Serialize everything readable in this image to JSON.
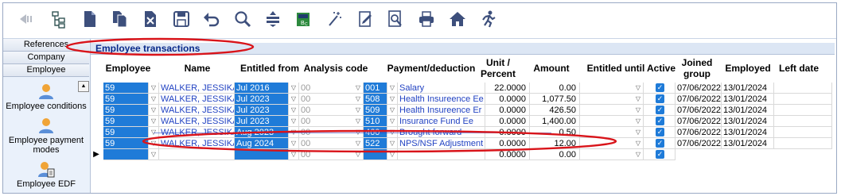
{
  "left_panel": {
    "tabs": [
      "References",
      "Company",
      "Employee"
    ],
    "items": [
      {
        "label": "Employee conditions",
        "icon": "person-icon"
      },
      {
        "label": "Employee payment modes",
        "icon": "person-icon"
      },
      {
        "label": "Employee EDF",
        "icon": "person-document-icon"
      }
    ]
  },
  "section_title": "Employee transactions",
  "columns": {
    "employee": "Employee",
    "name": "Name",
    "entitled_from": "Entitled from",
    "analysis_code": "Analysis code",
    "payment": "Payment/deduction",
    "unit": "Unit / Percent",
    "amount": "Amount",
    "entitled_until": "Entitled until",
    "active": "Active",
    "joined": "Joined group",
    "employed": "Employed",
    "left": "Left date"
  },
  "rows": [
    {
      "emp": "59",
      "name": "WALKER, JESSIKA",
      "from": "Jul 2016",
      "code": "00",
      "pay_no": "001",
      "pay": "Salary",
      "unit": "22.0000",
      "amount": "0.00",
      "joined": "07/06/2022",
      "employed": "13/01/2024"
    },
    {
      "emp": "59",
      "name": "WALKER, JESSIKA",
      "from": "Jul 2023",
      "code": "00",
      "pay_no": "508",
      "pay": "Health Insureence Ee",
      "unit": "0.0000",
      "amount": "1,077.50",
      "joined": "07/06/2022",
      "employed": "13/01/2024"
    },
    {
      "emp": "59",
      "name": "WALKER, JESSIKA",
      "from": "Jul 2023",
      "code": "00",
      "pay_no": "509",
      "pay": "Health Insureence Er",
      "unit": "0.0000",
      "amount": "426.50",
      "joined": "07/06/2022",
      "employed": "13/01/2024"
    },
    {
      "emp": "59",
      "name": "WALKER, JESSIKA",
      "from": "Jul 2023",
      "code": "00",
      "pay_no": "510",
      "pay": "Insurance Fund Ee",
      "unit": "0.0000",
      "amount": "1,400.00",
      "joined": "07/06/2022",
      "employed": "13/01/2024"
    },
    {
      "emp": "59",
      "name": "WALKER, JESSIKA",
      "from": "Aug 2023",
      "code": "00",
      "pay_no": "460",
      "pay": "Brought forward",
      "unit": "0.0000",
      "amount": "0.50",
      "joined": "07/06/2022",
      "employed": "13/01/2024"
    },
    {
      "emp": "59",
      "name": "WALKER, JESSIKA",
      "from": "Aug 2024",
      "code": "00",
      "pay_no": "522",
      "pay": "NPS/NSF Adjustment",
      "unit": "0.0000",
      "amount": "12.00",
      "joined": "07/06/2022",
      "employed": "13/01/2024"
    }
  ],
  "new_row": {
    "code": "00",
    "unit": "0.0000",
    "amount": "0.00"
  },
  "colors": {
    "selection_blue": "#1f7bd8",
    "link_blue": "#2142c2",
    "annotation_red": "#d9141a"
  },
  "toolbar_icons": [
    "back-arrow-icon",
    "tree-icon",
    "document-icon",
    "copy-icon",
    "delete-icon",
    "save-icon",
    "undo-icon",
    "search-icon",
    "filter-icon",
    "calculator-icon",
    "wand-icon",
    "edit-document-icon",
    "preview-icon",
    "print-icon",
    "home-icon",
    "run-icon"
  ]
}
